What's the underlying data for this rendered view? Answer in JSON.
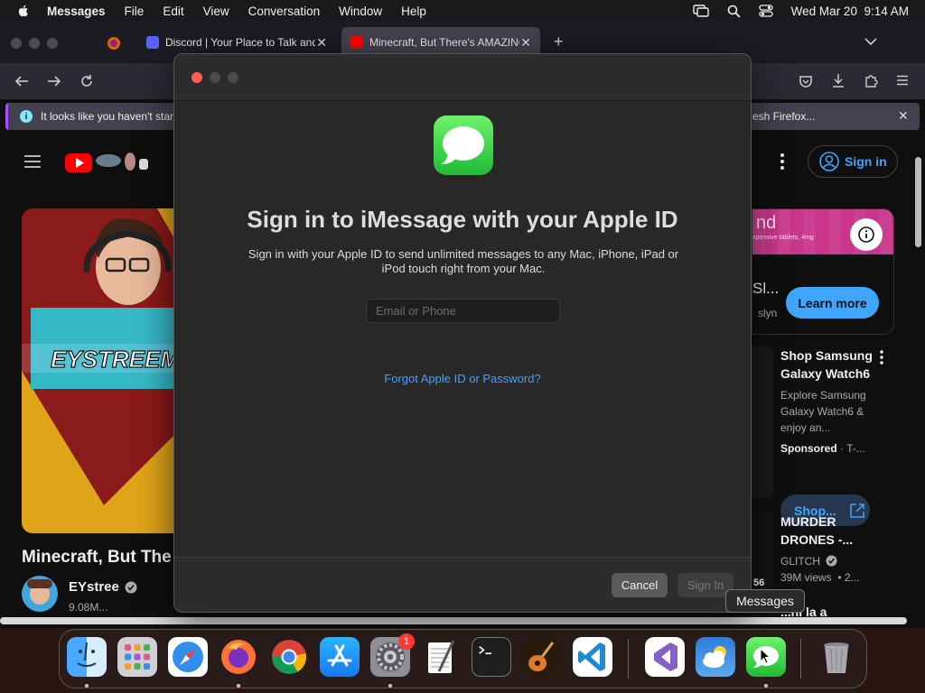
{
  "menubar": {
    "app_name": "Messages",
    "menus": [
      "File",
      "Edit",
      "View",
      "Conversation",
      "Window",
      "Help"
    ],
    "datetime": "Wed Mar 20  9:14 AM",
    "icons": [
      "apple-icon",
      "screen-mirroring-icon",
      "spotlight-search-icon",
      "control-center-icon"
    ]
  },
  "browser": {
    "tabs": [
      {
        "title": "Discord | Your Place to Talk and",
        "icon": "discord-icon"
      },
      {
        "title": "Minecraft, But There's AMAZING",
        "icon": "youtube-icon"
      }
    ],
    "notification": {
      "text_left": "It looks like you haven't start",
      "text_right": "esh Firefox..."
    }
  },
  "youtube": {
    "sign_in": "Sign in",
    "video_title": "Minecraft, But The",
    "channel_name": "EYstree",
    "channel_subs": "9.08M...",
    "thumb_text": "EYSTREEM",
    "ad": {
      "brand_fragment": "nd",
      "brand_sub": "xpensive tablets, 4mg",
      "title_fragment": "Sl...",
      "sub_fragment": "slyn",
      "cta": "Learn more"
    },
    "sponsored_card": {
      "title": "Shop Samsung Galaxy Watch6",
      "description": "Explore Samsung Galaxy Watch6 & enjoy an...",
      "sponsored_label": "Sponsored",
      "sponsored_suffix": "· T-...",
      "shop_label": "Shop..."
    },
    "next_video": {
      "title": "MURDER DRONES -...",
      "channel": "GLITCH",
      "stats": "39M views  • 2...",
      "duration_fragment": "56",
      "below_fragment": "...ni la a"
    }
  },
  "dialog": {
    "heading": "Sign in to iMessage with your Apple ID",
    "description": "Sign in with your Apple ID to send unlimited messages to any Mac, iPhone, iPad or iPod touch right from your Mac.",
    "input_placeholder": "Email or Phone",
    "input_value": "",
    "forgot_link": "Forgot Apple ID or Password?",
    "cancel_label": "Cancel",
    "signin_label": "Sign In"
  },
  "dock": {
    "items": [
      "Finder",
      "Launchpad",
      "Safari",
      "Firefox",
      "Chrome",
      "App Store",
      "System Settings",
      "TextEdit",
      "Terminal",
      "GarageBand",
      "Visual Studio Code",
      "Visual Studio",
      "Weather",
      "Messages",
      "Trash"
    ],
    "settings_badge": "1",
    "tooltip": "Messages"
  },
  "colors": {
    "accent_blue": "#3ea6ff",
    "link_blue": "#4a9eff",
    "close_red": "#ff5f57",
    "messages_green": "#28c840",
    "youtube_red": "#ff0000"
  }
}
